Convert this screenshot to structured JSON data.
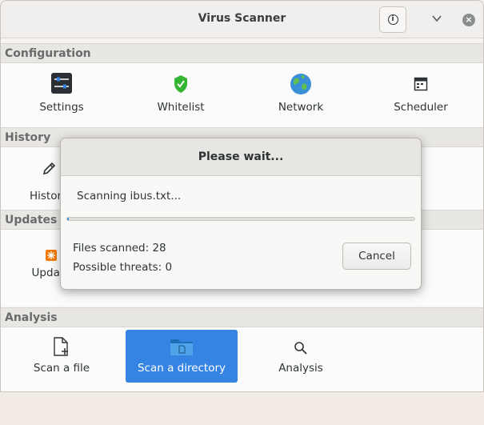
{
  "window": {
    "title": "Virus Scanner",
    "info_icon": "info-icon",
    "menu_icon": "chevron-down-icon",
    "close_icon": "close-icon",
    "close_glyph": "×"
  },
  "sections": {
    "configuration": {
      "label": "Configuration",
      "items": [
        {
          "label": "Settings",
          "icon": "settings-sliders-icon"
        },
        {
          "label": "Whitelist",
          "icon": "shield-check-icon"
        },
        {
          "label": "Network",
          "icon": "globe-icon"
        },
        {
          "label": "Scheduler",
          "icon": "calendar-icon"
        }
      ]
    },
    "history": {
      "label": "History",
      "items": [
        {
          "label": "History",
          "icon": "pencil-icon"
        }
      ]
    },
    "updates": {
      "label": "Updates",
      "items": [
        {
          "label": "Update",
          "icon": "update-burst-icon"
        }
      ]
    },
    "analysis": {
      "label": "Analysis",
      "items": [
        {
          "label": "Scan a file",
          "icon": "file-add-icon"
        },
        {
          "label": "Scan a directory",
          "icon": "folder-icon"
        },
        {
          "label": "Analysis",
          "icon": "magnifier-icon"
        }
      ]
    }
  },
  "dialog": {
    "title": "Please wait...",
    "status": "Scanning ibus.txt...",
    "progress": 0.005,
    "files_scanned": "Files scanned: 28",
    "threats": "Possible threats: 0",
    "cancel_label": "Cancel"
  },
  "colors": {
    "accent": "#3584e4",
    "shield": "#33b533"
  }
}
